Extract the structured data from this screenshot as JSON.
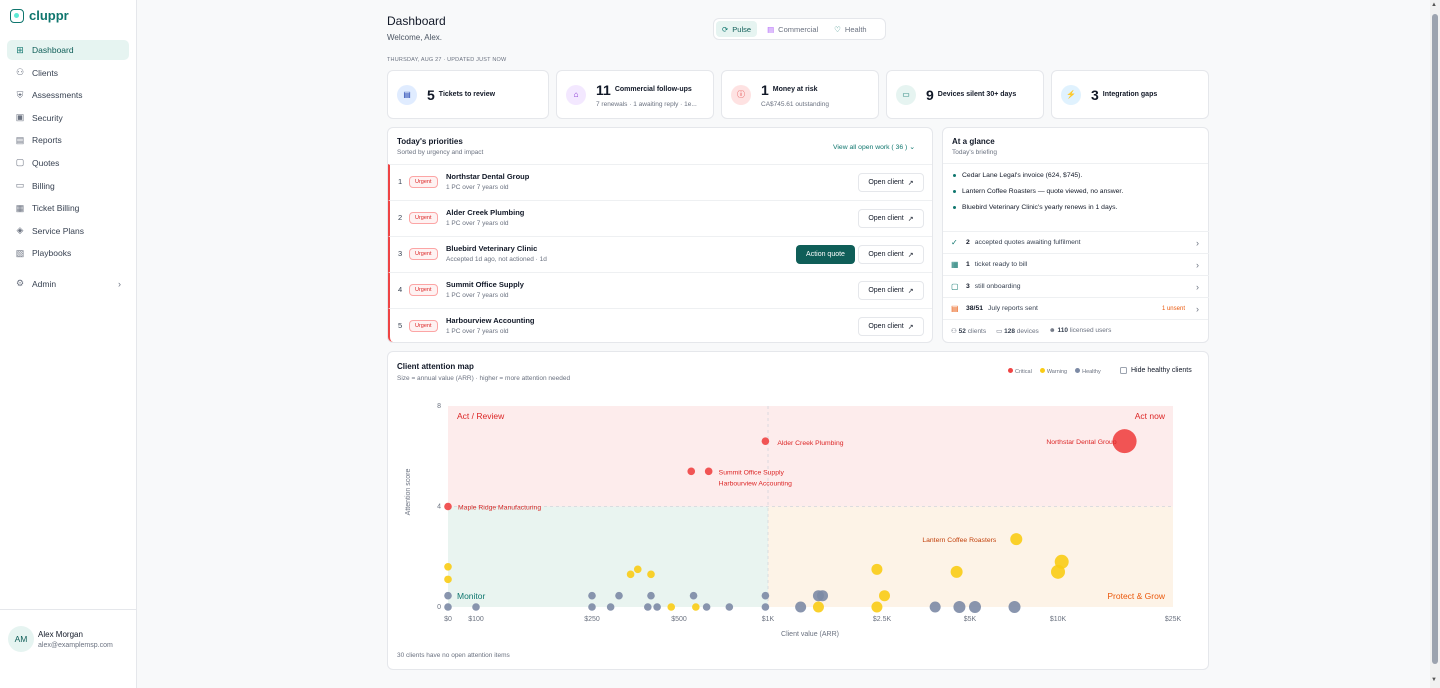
{
  "app": {
    "brand": "cluppr"
  },
  "sidebar": {
    "items": [
      {
        "label": "Dashboard",
        "icon": "grid-icon"
      },
      {
        "label": "Clients",
        "icon": "users-icon"
      },
      {
        "label": "Assessments",
        "icon": "shield-check-icon"
      },
      {
        "label": "Security",
        "icon": "lock-icon"
      },
      {
        "label": "Reports",
        "icon": "bar-chart-icon"
      },
      {
        "label": "Quotes",
        "icon": "document-icon"
      },
      {
        "label": "Billing",
        "icon": "credit-card-icon"
      },
      {
        "label": "Ticket Billing",
        "icon": "receipt-icon"
      },
      {
        "label": "Service Plans",
        "icon": "layers-icon"
      },
      {
        "label": "Playbooks",
        "icon": "book-icon"
      }
    ],
    "admin": {
      "label": "Admin",
      "icon": "gear-icon"
    }
  },
  "user": {
    "initials": "AM",
    "name": "Alex Morgan",
    "email": "alex@examplemsp.com"
  },
  "header": {
    "title": "Dashboard",
    "welcome": "Welcome, Alex.",
    "date_line": "THURSDAY, AUG 27 · UPDATED JUST NOW",
    "views": [
      {
        "label": "Pulse",
        "icon": "pulse-icon"
      },
      {
        "label": "Commercial",
        "icon": "bar-chart-icon"
      },
      {
        "label": "Health",
        "icon": "heart-icon"
      }
    ]
  },
  "kpis": [
    {
      "value": "5",
      "label": "Tickets to review",
      "sub": "",
      "icon": "ticket-icon",
      "color": "#1e40af",
      "bg": "#e0ecff"
    },
    {
      "value": "11",
      "label": "Commercial follow-ups",
      "sub": "7 renewals · 1 awaiting reply · 1e...",
      "icon": "building-icon",
      "color": "#7e22ce",
      "bg": "#f3e8ff"
    },
    {
      "value": "1",
      "label": "Money at risk",
      "sub": "CA$745.61 outstanding",
      "icon": "alert-circle-icon",
      "color": "#dc2626",
      "bg": "#fee2e2"
    },
    {
      "value": "9",
      "label": "Devices silent 30+ days",
      "sub": "",
      "icon": "monitor-off-icon",
      "color": "#0f766e",
      "bg": "#e6f4f1"
    },
    {
      "value": "3",
      "label": "Integration gaps",
      "sub": "",
      "icon": "plug-icon",
      "color": "#0369a1",
      "bg": "#e0f2fe"
    }
  ],
  "priorities": {
    "title": "Today's priorities",
    "subtitle": "Sorted by urgency and impact",
    "view_all": "View all open work ( 36 )",
    "badge": "Urgent",
    "open_label": "Open client",
    "action_label": "Action quote",
    "rows": [
      {
        "num": "1",
        "name": "Northstar Dental Group",
        "detail": "1 PC over 7 years old",
        "action": false
      },
      {
        "num": "2",
        "name": "Alder Creek Plumbing",
        "detail": "1 PC over 7 years old",
        "action": false
      },
      {
        "num": "3",
        "name": "Bluebird Veterinary Clinic",
        "detail": "Accepted 1d ago, not actioned · 1d",
        "action": true
      },
      {
        "num": "4",
        "name": "Summit Office Supply",
        "detail": "1 PC over 7 years old",
        "action": false
      },
      {
        "num": "5",
        "name": "Harbourview Accounting",
        "detail": "1 PC over 7 years old",
        "action": false
      }
    ]
  },
  "glance": {
    "title": "At a glance",
    "subtitle": "Today's briefing",
    "bullets": [
      "Cedar Lane Legal's invoice (624, $745).",
      "Lantern Coffee Roasters — quote viewed, no answer.",
      "Bluebird Veterinary Clinic's yearly renews in 1 days."
    ],
    "rows": [
      {
        "count": "2",
        "label": "accepted quotes awaiting fulfilment",
        "icon": "check-circle-icon",
        "note": ""
      },
      {
        "count": "1",
        "label": "ticket ready to bill",
        "icon": "receipt-icon",
        "note": ""
      },
      {
        "count": "3",
        "label": "still onboarding",
        "icon": "document-icon",
        "note": ""
      },
      {
        "count": "38/51",
        "label": "July reports sent",
        "icon": "report-icon",
        "note": "1 unsent"
      }
    ],
    "footer": [
      {
        "count": "52",
        "label": "clients",
        "icon": "users-icon"
      },
      {
        "count": "128",
        "label": "devices",
        "icon": "monitor-icon"
      },
      {
        "count": "110",
        "label": "licensed users",
        "icon": "user-icon"
      }
    ]
  },
  "map": {
    "title": "Client attention map",
    "subtitle": "Size = annual value (ARR) · higher = more attention needed",
    "legend": [
      {
        "label": "Critical",
        "color": "#ef4444"
      },
      {
        "label": "Warning",
        "color": "#facc15"
      },
      {
        "label": "Healthy",
        "color": "#7c8aa5"
      }
    ],
    "hide_label": "Hide healthy clients",
    "footnote": "30 clients have no open attention items"
  },
  "chart_data": {
    "type": "scatter",
    "xlabel": "Client value (ARR)",
    "ylabel": "Attention score",
    "x_ticks": [
      "$0",
      "$100",
      "$250",
      "$500",
      "$1K",
      "$2.5K",
      "$5K",
      "$10K",
      "$25K"
    ],
    "y_ticks": [
      "0",
      "4",
      "8"
    ],
    "ylim": [
      0,
      8
    ],
    "quadrants": [
      {
        "label": "Act / Review",
        "color": "#dc2626"
      },
      {
        "label": "Act now",
        "color": "#dc2626"
      },
      {
        "label": "Monitor",
        "color": "#0f766e"
      },
      {
        "label": "Protect & Grow",
        "color": "#ea580c"
      }
    ],
    "points": [
      {
        "x": 17000,
        "y": 6.6,
        "status": "critical",
        "label": "Northstar Dental Group"
      },
      {
        "x": 980,
        "y": 6.6,
        "status": "critical",
        "label": "Alder Creek Plumbing"
      },
      {
        "x": 550,
        "y": 5.4,
        "status": "critical",
        "label": ""
      },
      {
        "x": 630,
        "y": 5.4,
        "status": "critical",
        "label": "Summit Office Supply"
      },
      {
        "x": 630,
        "y": 5.4,
        "status": "critical",
        "label": "Harbourview Accounting"
      },
      {
        "x": 0,
        "y": 4.0,
        "status": "critical",
        "label": "Maple Ridge Manufacturing"
      },
      {
        "x": 7200,
        "y": 2.7,
        "status": "warning",
        "label": "Lantern Coffee Roasters"
      },
      {
        "x": 2400,
        "y": 1.5,
        "status": "warning",
        "label": ""
      },
      {
        "x": 4500,
        "y": 1.4,
        "status": "warning",
        "label": ""
      },
      {
        "x": 10300,
        "y": 1.8,
        "status": "warning",
        "label": ""
      },
      {
        "x": 10000,
        "y": 1.4,
        "status": "warning",
        "label": ""
      },
      {
        "x": 2550,
        "y": 0.45,
        "status": "warning",
        "label": ""
      },
      {
        "x": 2400,
        "y": 0,
        "status": "warning",
        "label": ""
      },
      {
        "x": 0,
        "y": 1.6,
        "status": "warning",
        "label": ""
      },
      {
        "x": 0,
        "y": 1.1,
        "status": "warning",
        "label": ""
      },
      {
        "x": 340,
        "y": 1.3,
        "status": "warning",
        "label": ""
      },
      {
        "x": 360,
        "y": 1.5,
        "status": "warning",
        "label": ""
      },
      {
        "x": 400,
        "y": 1.3,
        "status": "warning",
        "label": ""
      },
      {
        "x": 470,
        "y": 0,
        "status": "warning",
        "label": ""
      },
      {
        "x": 570,
        "y": 0,
        "status": "warning",
        "label": ""
      },
      {
        "x": 1500,
        "y": 0,
        "status": "warning",
        "label": ""
      },
      {
        "x": 0,
        "y": 0.45,
        "status": "healthy",
        "label": ""
      },
      {
        "x": 0,
        "y": 0,
        "status": "healthy",
        "label": ""
      },
      {
        "x": 100,
        "y": 0,
        "status": "healthy",
        "label": ""
      },
      {
        "x": 250,
        "y": 0,
        "status": "healthy",
        "label": ""
      },
      {
        "x": 250,
        "y": 0.45,
        "status": "healthy",
        "label": ""
      },
      {
        "x": 290,
        "y": 0,
        "status": "healthy",
        "label": ""
      },
      {
        "x": 310,
        "y": 0.45,
        "status": "healthy",
        "label": ""
      },
      {
        "x": 390,
        "y": 0,
        "status": "healthy",
        "label": ""
      },
      {
        "x": 400,
        "y": 0.45,
        "status": "healthy",
        "label": ""
      },
      {
        "x": 420,
        "y": 0,
        "status": "healthy",
        "label": ""
      },
      {
        "x": 560,
        "y": 0.45,
        "status": "healthy",
        "label": ""
      },
      {
        "x": 620,
        "y": 0,
        "status": "healthy",
        "label": ""
      },
      {
        "x": 740,
        "y": 0,
        "status": "healthy",
        "label": ""
      },
      {
        "x": 980,
        "y": 0.45,
        "status": "healthy",
        "label": ""
      },
      {
        "x": 980,
        "y": 0,
        "status": "healthy",
        "label": ""
      },
      {
        "x": 1300,
        "y": 0,
        "status": "healthy",
        "label": ""
      },
      {
        "x": 1500,
        "y": 0.45,
        "status": "healthy",
        "label": ""
      },
      {
        "x": 1550,
        "y": 0.45,
        "status": "healthy",
        "label": ""
      },
      {
        "x": 3800,
        "y": 0,
        "status": "healthy",
        "label": ""
      },
      {
        "x": 4600,
        "y": 0,
        "status": "healthy",
        "label": ""
      },
      {
        "x": 5200,
        "y": 0,
        "status": "healthy",
        "label": ""
      },
      {
        "x": 7100,
        "y": 0,
        "status": "healthy",
        "label": ""
      }
    ]
  }
}
